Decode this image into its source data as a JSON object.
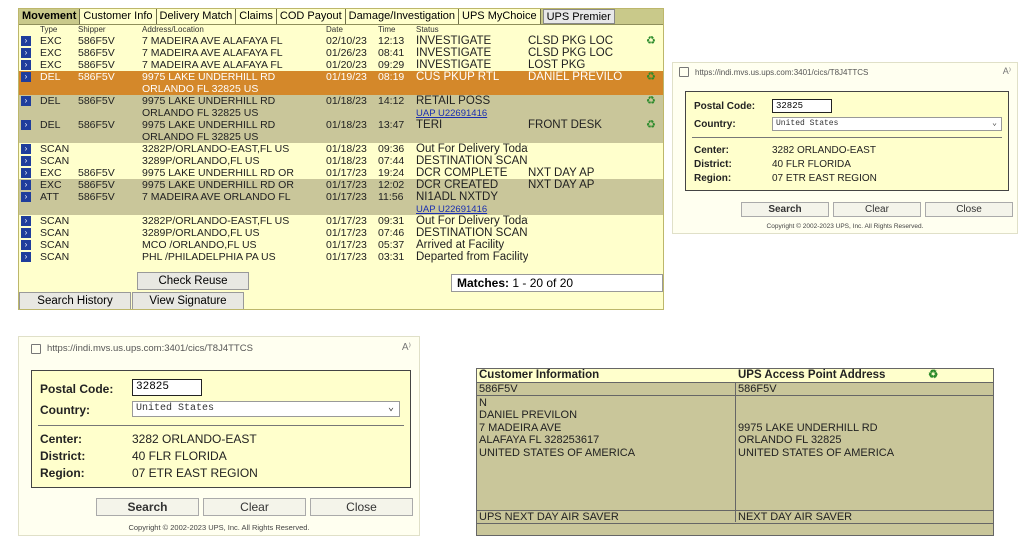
{
  "movement": {
    "tabs": [
      "Movement",
      "Customer Info",
      "Delivery Match",
      "Claims",
      "COD Payout",
      "Damage/Investigation",
      "UPS MyChoice",
      "UPS Premier"
    ],
    "columns": [
      "Type",
      "Shipper",
      "Address/Location",
      "Date",
      "Time",
      "Status"
    ],
    "rows": [
      {
        "type": "EXC",
        "shipper": "586F5V",
        "addr1": "7 MADEIRA AVE ALAFAYA FL",
        "addr2": "",
        "date": "02/10/23",
        "time": "12:13",
        "status": "INVESTIGATE",
        "status2": "",
        "extra": "CLSD PKG LOC",
        "icon": true
      },
      {
        "type": "EXC",
        "shipper": "586F5V",
        "addr1": "7 MADEIRA AVE ALAFAYA FL",
        "addr2": "",
        "date": "01/26/23",
        "time": "08:41",
        "status": "INVESTIGATE",
        "status2": "",
        "extra": "CLSD PKG LOC",
        "icon": false
      },
      {
        "type": "EXC",
        "shipper": "586F5V",
        "addr1": "7 MADEIRA AVE ALAFAYA FL",
        "addr2": "",
        "date": "01/20/23",
        "time": "09:29",
        "status": "INVESTIGATE",
        "status2": "",
        "extra": "LOST PKG",
        "icon": false
      },
      {
        "type": "DEL",
        "shipper": "586F5V",
        "addr1": "9975 LAKE UNDERHILL RD",
        "addr2": "ORLANDO FL 32825 US",
        "date": "01/19/23",
        "time": "08:19",
        "status": "CUS PKUP RTL",
        "status2": "",
        "extra": "DANIEL PREVILO",
        "icon": true
      },
      {
        "type": "DEL",
        "shipper": "586F5V",
        "addr1": "9975 LAKE UNDERHILL RD",
        "addr2": "ORLANDO FL 32825 US",
        "date": "01/18/23",
        "time": "14:12",
        "status": "RETAIL POSS",
        "status2": "UAP U22691416",
        "extra": "",
        "icon": true
      },
      {
        "type": "DEL",
        "shipper": "586F5V",
        "addr1": "9975 LAKE UNDERHILL RD",
        "addr2": "ORLANDO FL 32825 US",
        "date": "01/18/23",
        "time": "13:47",
        "status": "TERI",
        "status2": "",
        "extra": "FRONT DESK",
        "icon": true
      },
      {
        "type": "SCAN",
        "shipper": "",
        "addr1": "3282P/ORLANDO-EAST,FL US",
        "addr2": "",
        "date": "01/18/23",
        "time": "09:36",
        "status": "Out For Delivery Today",
        "status2": "",
        "extra": "",
        "icon": false
      },
      {
        "type": "SCAN",
        "shipper": "",
        "addr1": "3289P/ORLANDO,FL US",
        "addr2": "",
        "date": "01/18/23",
        "time": "07:44",
        "status": "DESTINATION SCAN",
        "status2": "",
        "extra": "",
        "icon": false
      },
      {
        "type": "EXC",
        "shipper": "586F5V",
        "addr1": "9975 LAKE UNDERHILL RD OR",
        "addr2": "",
        "date": "01/17/23",
        "time": "19:24",
        "status": "DCR COMPLETE",
        "status2": "",
        "extra": "NXT DAY AP",
        "icon": false
      },
      {
        "type": "EXC",
        "shipper": "586F5V",
        "addr1": "9975 LAKE UNDERHILL RD OR",
        "addr2": "",
        "date": "01/17/23",
        "time": "12:02",
        "status": "DCR CREATED",
        "status2": "",
        "extra": "NXT DAY AP",
        "icon": false
      },
      {
        "type": "ATT",
        "shipper": "586F5V",
        "addr1": "7 MADEIRA AVE ORLANDO FL",
        "addr2": "",
        "date": "01/17/23",
        "time": "11:56",
        "status": "NI1ADL NXTDY",
        "status2": "UAP U22691416",
        "extra": "",
        "icon": false
      },
      {
        "type": "SCAN",
        "shipper": "",
        "addr1": "3282P/ORLANDO-EAST,FL US",
        "addr2": "",
        "date": "01/17/23",
        "time": "09:31",
        "status": "Out For Delivery Today",
        "status2": "",
        "extra": "",
        "icon": false
      },
      {
        "type": "SCAN",
        "shipper": "",
        "addr1": "3289P/ORLANDO,FL US",
        "addr2": "",
        "date": "01/17/23",
        "time": "07:46",
        "status": "DESTINATION SCAN",
        "status2": "",
        "extra": "",
        "icon": false
      },
      {
        "type": "SCAN",
        "shipper": "",
        "addr1": "MCO /ORLANDO,FL US",
        "addr2": "",
        "date": "01/17/23",
        "time": "05:37",
        "status": "Arrived at Facility",
        "status2": "",
        "extra": "",
        "icon": false
      },
      {
        "type": "SCAN",
        "shipper": "",
        "addr1": "PHL /PHILADELPHIA PA US",
        "addr2": "",
        "date": "01/17/23",
        "time": "03:31",
        "status": "Departed from Facility",
        "status2": "",
        "extra": "",
        "icon": false
      }
    ],
    "check_reuse": "Check Reuse",
    "search_history": "Search History",
    "view_signature": "View Signature",
    "matches_label": "Matches:",
    "matches_value": "1 - 20 of 20"
  },
  "lookup": {
    "url": "https://indi.mvs.us.ups.com:3401/cics/T8J4TTCS",
    "reader_icon": "A⁾",
    "postal_label": "Postal Code:",
    "postal_value": "32825",
    "country_label": "Country:",
    "country_value": "United States",
    "center_label": "Center:",
    "center_value": "3282 ORLANDO-EAST",
    "district_label": "District:",
    "district_value": "40 FLR FLORIDA",
    "region_label": "Region:",
    "region_value": "07 ETR EAST REGION",
    "search": "Search",
    "clear": "Clear",
    "close": "Close",
    "copyright": "Copyright © 2002-2023 UPS, Inc. All Rights Reserved."
  },
  "customer": {
    "header_left": "Customer Information",
    "header_right": "UPS Access Point Address",
    "left_lines": [
      "586F5V",
      "N",
      "DANIEL PREVILON",
      "7 MADEIRA AVE",
      "ALAFAYA FL 328253617",
      "UNITED STATES OF AMERICA"
    ],
    "right_lines": [
      "586F5V",
      "",
      "",
      "9975 LAKE UNDERHILL RD",
      "ORLANDO FL 32825",
      "UNITED STATES OF AMERICA"
    ],
    "service_left": "UPS NEXT DAY AIR SAVER",
    "service_right": "NEXT DAY AIR SAVER"
  }
}
